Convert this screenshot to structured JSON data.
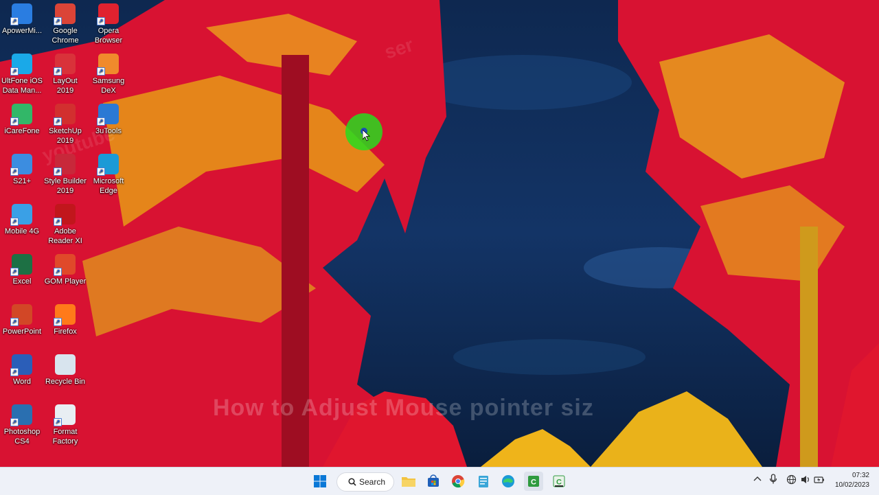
{
  "desktop": {
    "icons": [
      {
        "label": "ApowerMi...",
        "icon": "apowermirror-icon",
        "color": "#2a7de1"
      },
      {
        "label": "Google Chrome",
        "icon": "chrome-icon",
        "color": "#db4437"
      },
      {
        "label": "Opera Browser",
        "icon": "opera-icon",
        "color": "#e0222f"
      },
      {
        "label": "UltFone iOS Data Man...",
        "icon": "ultfone-icon",
        "color": "#1aa9e8"
      },
      {
        "label": "LayOut 2019",
        "icon": "layout-icon",
        "color": "#d9323a"
      },
      {
        "label": "Samsung DeX",
        "icon": "samsung-dex-icon",
        "color": "#f08a2c"
      },
      {
        "label": "iCareFone",
        "icon": "icarefone-icon",
        "color": "#32b768"
      },
      {
        "label": "SketchUp 2019",
        "icon": "sketchup-icon",
        "color": "#d22f2f"
      },
      {
        "label": "3uTools",
        "icon": "3utools-icon",
        "color": "#2b79d4"
      },
      {
        "label": "S21+",
        "icon": "s21-icon",
        "color": "#3c8de0"
      },
      {
        "label": "Style Builder 2019",
        "icon": "style-builder-icon",
        "color": "#c8283a"
      },
      {
        "label": "Microsoft Edge",
        "icon": "edge-icon",
        "color": "#1b9ad6"
      },
      {
        "label": "Mobile 4G",
        "icon": "mobile-4g-icon",
        "color": "#3aa0e6"
      },
      {
        "label": "Adobe Reader XI",
        "icon": "adobe-reader-icon",
        "color": "#c1161c"
      },
      {
        "label": "Excel",
        "icon": "excel-icon",
        "color": "#1d7044"
      },
      {
        "label": "GOM Player",
        "icon": "gom-player-icon",
        "color": "#e0492a"
      },
      {
        "label": "PowerPoint",
        "icon": "powerpoint-icon",
        "color": "#d24726"
      },
      {
        "label": "Firefox",
        "icon": "firefox-icon",
        "color": "#ff7a1a"
      },
      {
        "label": "Word",
        "icon": "word-icon",
        "color": "#2b5eb8"
      },
      {
        "label": "Recycle Bin",
        "icon": "recycle-bin-icon",
        "color": "#d8e4ee"
      },
      {
        "label": "Photoshop CS4",
        "icon": "photoshop-icon",
        "color": "#2a6fb0"
      },
      {
        "label": "Format Factory",
        "icon": "format-factory-icon",
        "color": "#e8eef3"
      }
    ],
    "watermark": "How to Adjust Mouse pointer siz"
  },
  "taskbar": {
    "search_label": "Search",
    "pinned": [
      "start-icon",
      "file-explorer-icon",
      "store-icon",
      "chrome-icon",
      "notepad-icon",
      "edge-icon",
      "camtasia-icon",
      "camtasia-recorder-icon"
    ],
    "clock_time": "07:32",
    "clock_date": "10/02/2023"
  },
  "colors": {
    "sky": "#0c2445",
    "tree_red": "#e0162e",
    "tree_yellow": "#f0b418",
    "taskbar": "#eef1f8",
    "cursor_highlight": "#28dc1e"
  }
}
